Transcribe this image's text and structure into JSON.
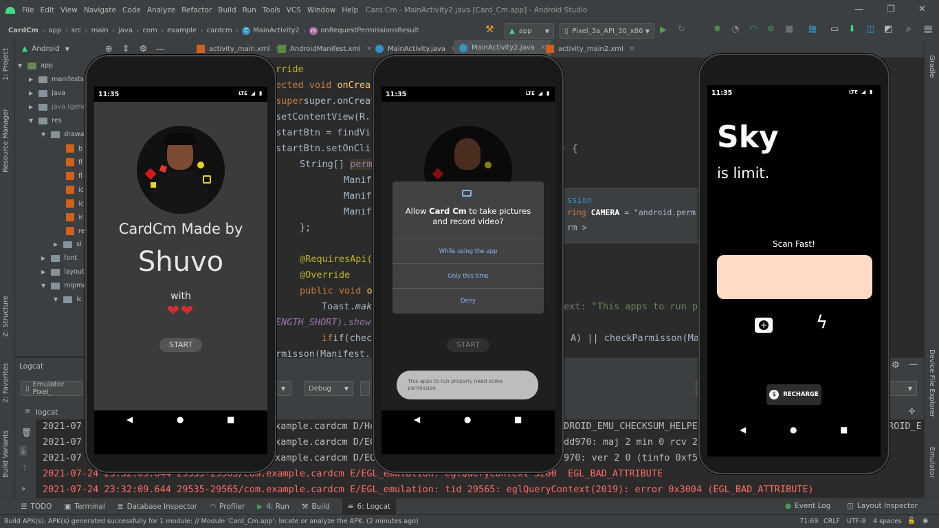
{
  "menubar": {
    "items": [
      "File",
      "Edit",
      "View",
      "Navigate",
      "Code",
      "Analyze",
      "Refactor",
      "Build",
      "Run",
      "Tools",
      "VCS",
      "Window",
      "Help"
    ],
    "title": "Card Cm - MainActivity2.java [Card_Cm.app] - Android Studio"
  },
  "navbar": {
    "crumbs": [
      "CardCm",
      "app",
      "src",
      "main",
      "java",
      "com",
      "example",
      "cardcm"
    ],
    "class_name": "MainActivity2",
    "method_name": "onRequestPermissionsResult",
    "module": "app",
    "device": "Pixel_3a_API_30_x86"
  },
  "project": {
    "view_mode": "Android",
    "tree": [
      "app",
      "manifests",
      "java",
      "java (generated)",
      "res",
      "drawable",
      "b",
      "fl",
      "fl",
      "ic",
      "ic",
      "ic",
      "re",
      "sl",
      "font",
      "layout",
      "mipmap",
      "ic"
    ]
  },
  "left_tabs": [
    "1: Project",
    "Resource Manager",
    "Z: Structure",
    "2: Favorites",
    "Build Variants"
  ],
  "right_tabs": [
    "Gradle",
    "Device File Explorer",
    "Emulator"
  ],
  "editor_tabs": [
    "activity_main.xml",
    "AndroidManifest.xml",
    "MainActivity.java",
    "MainActivity2.java",
    "activity_main2.xml"
  ],
  "code": {
    "l1": "rride",
    "l2a": "ected void ",
    "l2b": "onCrea",
    "l3": "super.onCreate(sa",
    "l4": "setContentView(R.",
    "l5": "startBtn = findVi",
    "l6": "startBtn.setOnCli",
    "l6b": ") {",
    "l7a": "String[] ",
    "l7b": "perm",
    "l8": "Manif",
    "l9": "Manif",
    "l10": "Manif",
    "l11": "};",
    "l12": "@RequiresApi(",
    "l13": "@Override",
    "l14a": "public void ",
    "l14b": "o",
    "l15a": "Toast.",
    "l15b": "mak",
    "l15c": "ext: ",
    "l15d": "\"This apps to run pro",
    "l16": "ENGTH_SHORT).show",
    "l17": "if(checkP",
    "l17b": "A) || checkParmisson(Man",
    "l18": "rmisson(Manifest."
  },
  "popup": {
    "l1": "ssion",
    "l2a": "ring ",
    "l2b": "CAMERA",
    "l2c": " = \"android.perm",
    "l3": "rm >"
  },
  "logcat": {
    "title": "Logcat",
    "device": "Emulator Pixel_",
    "level": "Debug",
    "sub": "logcat",
    "lines": [
      {
        "date": "2021-07",
        "mid": "xample.cardcm D/Hos",
        "end": "DROID_EMU_CHECKSUM_HELPE",
        "end2": "ROID_E"
      },
      {
        "date": "2021-07",
        "mid": "xample.cardcm D/EGL",
        "end": "dd970: maj 2 min 0 rcv 2"
      },
      {
        "date": "2021-07",
        "mid": "xample.cardcm D/EGL",
        "end": "970: ver 2 0 (tinfo 0xf5"
      }
    ],
    "error1": "2021-07-24 23:32:09.644 29535-29565/com.example.cardcm E/EGL_emulation: eglQueryContext 3200  EGL_BAD_ATTRIBUTE",
    "error2": "2021-07-24 23:32:09.644 29535-29565/com.example.cardcm E/EGL_emulation: tid 29565: eglQueryContext(2019): error 0x3004 (EGL_BAD_ATTRIBUTE)"
  },
  "bottom_tools": {
    "todo": "TODO",
    "terminal": "Terminal",
    "db": "Database Inspector",
    "profiler": "Profiler",
    "run": "4: Run",
    "build": "Build",
    "logcat": "6: Logcat",
    "event_log": "Event Log",
    "layout_inspector": "Layout Inspector"
  },
  "status": {
    "message": "Build APK(s): APK(s) generated successfully for 1 module: // Module 'Card_Cm.app': locate or analyze the APK. (2 minutes ago)",
    "position": "71:69",
    "line_sep": "CRLF",
    "encoding": "UTF-8",
    "indent": "4 spaces"
  },
  "phone1": {
    "time": "11:35",
    "signal": "LTE",
    "title": "CardCm Made by",
    "name": "Shuvo",
    "with": "with",
    "hearts": "❤❤",
    "button": "START"
  },
  "phone2": {
    "time": "11:35",
    "signal": "LTE",
    "dialog_pre": "Allow ",
    "dialog_app": "Card Cm",
    "dialog_post": " to take pictures and record video?",
    "opt1": "While using the app",
    "opt2": "Only this time",
    "opt3": "Deny",
    "button": "START",
    "toast": "This apps to run proparly need some permission"
  },
  "phone3": {
    "time": "11:35",
    "signal": "LTE",
    "headline": "Sky",
    "subline": "is limit.",
    "scan_label": "Scan Fast!",
    "recharge": "RECHARGE"
  },
  "colors": {
    "accent": "#4a88c7",
    "error": "#ff6b68",
    "scan_box": "#ffdac4",
    "android_green": "#3ddc84"
  }
}
